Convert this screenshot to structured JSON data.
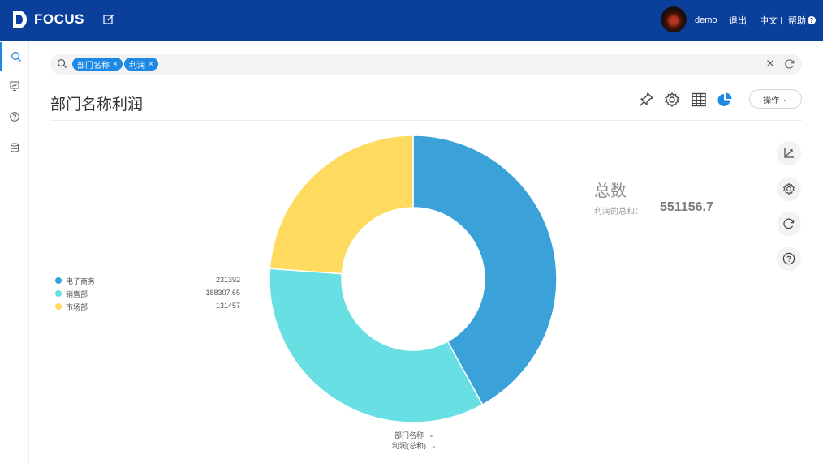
{
  "app": {
    "name": "FOCUS",
    "user": "demo",
    "logout": "退出",
    "lang": "中文",
    "help": "帮助"
  },
  "search": {
    "tokens": [
      {
        "label": "部门名称"
      },
      {
        "label": "利润"
      }
    ]
  },
  "page": {
    "title": "部门名称利润",
    "ops_label": "操作"
  },
  "summary": {
    "title": "总数",
    "label": "利润的总和：",
    "value": "551156.7"
  },
  "legend": [
    {
      "name": "电子商务",
      "value": "231392",
      "color": "#3aa2d9"
    },
    {
      "name": "销售部",
      "value": "188307.65",
      "color": "#67dfe3"
    },
    {
      "name": "市场部",
      "value": "131457",
      "color": "#fedb5e"
    }
  ],
  "axes": {
    "x_selector": "部门名称",
    "y_selector": "利润(总和)"
  },
  "chart_data": {
    "type": "pie",
    "donut": true,
    "categories": [
      "电子商务",
      "销售部",
      "市场部"
    ],
    "values": [
      231392,
      188307.65,
      131457
    ],
    "colors": [
      "#3aa2d9",
      "#67dfe3",
      "#fedb5e"
    ],
    "legend_position": "left"
  }
}
